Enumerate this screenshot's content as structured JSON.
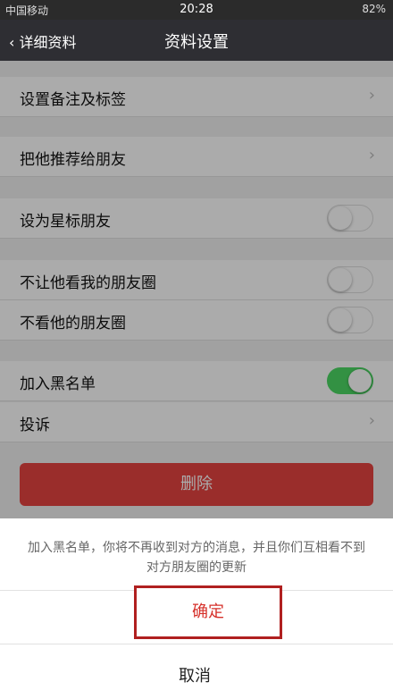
{
  "status_bar": {
    "carrier": "中国移动",
    "time": "20:28",
    "battery": "82%"
  },
  "navbar": {
    "back_label": "详细资料",
    "title": "资料设置"
  },
  "settings": {
    "set_note_tags": "设置备注及标签",
    "recommend_friend": "把他推荐给朋友",
    "star_friend": "设为星标朋友",
    "hide_my_moments": "不让他看我的朋友圈",
    "hide_his_moments": "不看他的朋友圈",
    "blacklist": "加入黑名单",
    "complain": "投诉"
  },
  "toggles": {
    "star_friend": false,
    "hide_my_moments": false,
    "hide_his_moments": false,
    "blacklist": true
  },
  "delete_button": "删除",
  "sheet": {
    "message": "加入黑名单，你将不再收到对方的消息，并且你们互相看不到对方朋友圈的更新",
    "confirm_label": "确定",
    "cancel_label": "取消"
  },
  "colors": {
    "accent_red": "#e64340",
    "toggle_on": "#4cd964",
    "nav_bg": "#2e2e33"
  }
}
